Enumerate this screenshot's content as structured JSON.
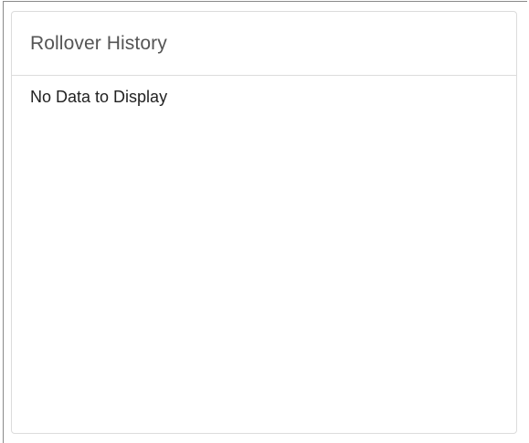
{
  "panel": {
    "title": "Rollover History",
    "empty_message": "No Data to Display"
  }
}
